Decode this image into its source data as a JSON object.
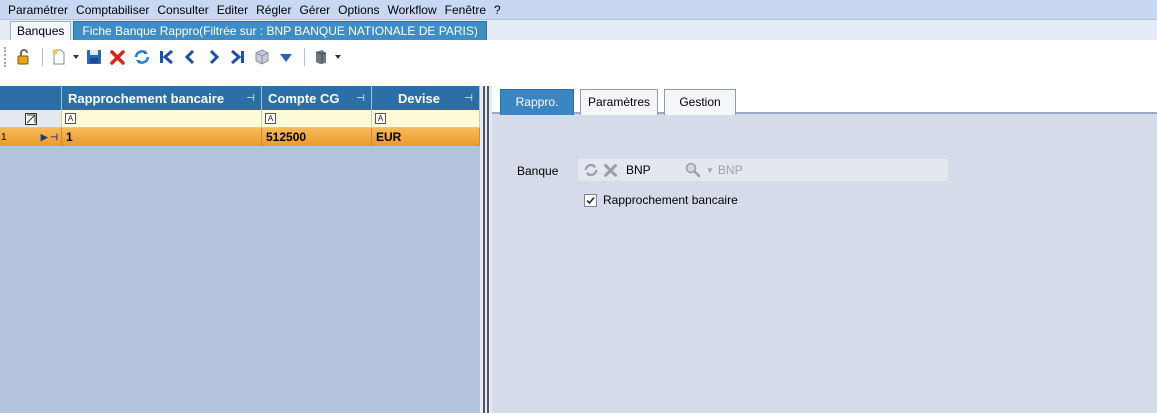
{
  "menu": {
    "items": [
      "Paramétrer",
      "Comptabiliser",
      "Consulter",
      "Editer",
      "Régler",
      "Gérer",
      "Options",
      "Workflow",
      "Fenêtre",
      "?"
    ]
  },
  "doc_tabs": [
    {
      "label": "Banques",
      "active": false
    },
    {
      "label": "Fiche Banque Rappro(Filtrée sur : BNP BANQUE NATIONALE DE PARIS)",
      "active": true
    }
  ],
  "toolbar": {
    "icons": [
      "unlock-icon",
      "new-record-icon",
      "save-icon",
      "delete-icon",
      "refresh-icon",
      "first-icon",
      "previous-icon",
      "next-icon",
      "last-icon",
      "cube-icon",
      "filter-icon",
      "export-icon"
    ]
  },
  "grid": {
    "columns": [
      {
        "label": "Rapprochement bancaire",
        "pin": "⊣"
      },
      {
        "label": "Compte CG",
        "pin": "⊣"
      },
      {
        "label": "Devise",
        "pin": "⊣"
      }
    ],
    "filter_placeholder": "A",
    "rows": [
      {
        "num": "1",
        "cells": [
          "1",
          "512500",
          "EUR"
        ]
      }
    ]
  },
  "panel_tabs": [
    {
      "label": "Rappro.",
      "active": true
    },
    {
      "label": "Paramètres",
      "active": false
    },
    {
      "label": "Gestion",
      "active": false
    }
  ],
  "form": {
    "banque_label": "Banque",
    "bank_code": "BNP",
    "bank_name": "BNP",
    "checkbox_label": "Rapprochement bancaire",
    "checkbox_checked": true
  },
  "colors": {
    "header_blue": "#2c6fa6",
    "row_selected": "#eb9a2c",
    "grid_bg": "#b3c3dc",
    "panel_bg": "#d6dbe9"
  }
}
